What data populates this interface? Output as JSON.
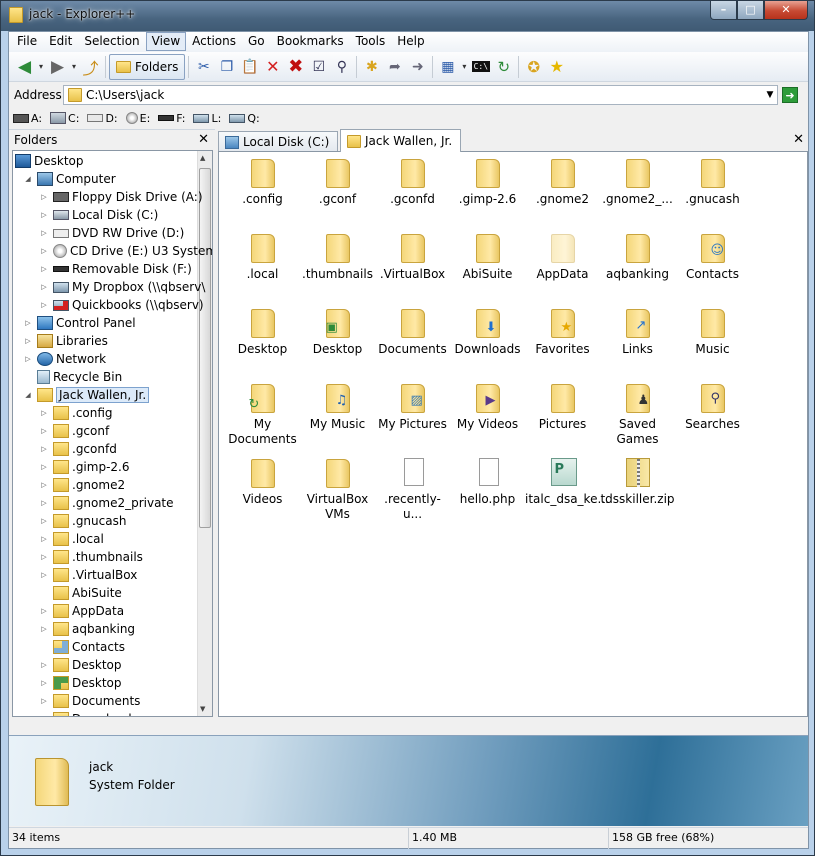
{
  "window": {
    "title": "jack - Explorer++",
    "min": "–",
    "max": "□",
    "close": "✕"
  },
  "menu": [
    "File",
    "Edit",
    "Selection",
    "View",
    "Actions",
    "Go",
    "Bookmarks",
    "Tools",
    "Help"
  ],
  "toolbar": {
    "folders_label": "Folders"
  },
  "address": {
    "label": "Address",
    "value": "C:\\Users\\jack"
  },
  "drives": [
    {
      "name": "floppy-drive",
      "label": "A:"
    },
    {
      "name": "local-drive",
      "label": "C:"
    },
    {
      "name": "dvd-drive",
      "label": "D:"
    },
    {
      "name": "cd-drive",
      "label": "E:"
    },
    {
      "name": "removable-drive",
      "label": "F:"
    },
    {
      "name": "network-drive-l",
      "label": "L:"
    },
    {
      "name": "network-drive-q",
      "label": "Q:"
    }
  ],
  "folders_pane": {
    "title": "Folders",
    "close": "✕"
  },
  "tree": [
    {
      "label": "Desktop",
      "icon": "desktop-icon",
      "level": 0,
      "exp": ""
    },
    {
      "label": "Computer",
      "icon": "computer-icon",
      "level": 1,
      "exp": "◢"
    },
    {
      "label": "Floppy Disk Drive (A:)",
      "icon": "floppy-icon",
      "level": 2,
      "exp": "▷"
    },
    {
      "label": "Local Disk (C:)",
      "icon": "hard-disk-icon",
      "level": 2,
      "exp": "▷"
    },
    {
      "label": "DVD RW Drive (D:)",
      "icon": "dvd-icon",
      "level": 2,
      "exp": "▷"
    },
    {
      "label": "CD Drive (E:) U3 System",
      "icon": "cd-icon",
      "level": 2,
      "exp": "▷"
    },
    {
      "label": "Removable Disk (F:)",
      "icon": "removable-disk-icon",
      "level": 2,
      "exp": "▷"
    },
    {
      "label": "My Dropbox (\\\\qbserv\\",
      "icon": "network-drive-icon",
      "level": 2,
      "exp": "▷"
    },
    {
      "label": "Quickbooks (\\\\qbserv)",
      "icon": "network-drive-disconnected-icon",
      "level": 2,
      "exp": "▷"
    },
    {
      "label": "Control Panel",
      "icon": "control-panel-icon",
      "level": 1,
      "exp": "▷"
    },
    {
      "label": "Libraries",
      "icon": "libraries-icon",
      "level": 1,
      "exp": "▷"
    },
    {
      "label": "Network",
      "icon": "network-icon",
      "level": 1,
      "exp": "▷"
    },
    {
      "label": "Recycle Bin",
      "icon": "recycle-bin-icon",
      "level": 1,
      "exp": ""
    },
    {
      "label": "Jack Wallen, Jr.",
      "icon": "user-folder-icon",
      "level": 1,
      "exp": "◢",
      "selected": true
    },
    {
      "label": ".config",
      "icon": "folder-icon",
      "level": 2,
      "exp": "▷"
    },
    {
      "label": ".gconf",
      "icon": "folder-icon",
      "level": 2,
      "exp": "▷"
    },
    {
      "label": ".gconfd",
      "icon": "folder-icon",
      "level": 2,
      "exp": "▷"
    },
    {
      "label": ".gimp-2.6",
      "icon": "folder-icon",
      "level": 2,
      "exp": "▷"
    },
    {
      "label": ".gnome2",
      "icon": "folder-icon",
      "level": 2,
      "exp": "▷"
    },
    {
      "label": ".gnome2_private",
      "icon": "folder-icon",
      "level": 2,
      "exp": "▷"
    },
    {
      "label": ".gnucash",
      "icon": "folder-icon",
      "level": 2,
      "exp": "▷"
    },
    {
      "label": ".local",
      "icon": "folder-icon",
      "level": 2,
      "exp": "▷"
    },
    {
      "label": ".thumbnails",
      "icon": "folder-icon",
      "level": 2,
      "exp": "▷"
    },
    {
      "label": ".VirtualBox",
      "icon": "folder-icon",
      "level": 2,
      "exp": "▷"
    },
    {
      "label": "AbiSuite",
      "icon": "folder-icon",
      "level": 2,
      "exp": ""
    },
    {
      "label": "AppData",
      "icon": "folder-icon",
      "level": 2,
      "exp": "▷"
    },
    {
      "label": "aqbanking",
      "icon": "folder-icon",
      "level": 2,
      "exp": "▷"
    },
    {
      "label": "Contacts",
      "icon": "contacts-folder-icon",
      "level": 2,
      "exp": ""
    },
    {
      "label": "Desktop",
      "icon": "folder-icon",
      "level": 2,
      "exp": "▷"
    },
    {
      "label": "Desktop",
      "icon": "desktop-shortcut-folder-icon",
      "level": 2,
      "exp": "▷"
    },
    {
      "label": "Documents",
      "icon": "folder-icon",
      "level": 2,
      "exp": "▷"
    },
    {
      "label": "Downloads",
      "icon": "folder-icon",
      "level": 2,
      "exp": ""
    }
  ],
  "tabs": [
    {
      "label": "Local Disk (C:)",
      "icon": "drive-tab-icon"
    },
    {
      "label": "Jack Wallen, Jr.",
      "icon": "user-folder-tab-icon"
    }
  ],
  "tab_close": "✕",
  "files": [
    {
      "label": ".config",
      "kind": "folder"
    },
    {
      "label": ".gconf",
      "kind": "folder"
    },
    {
      "label": ".gconfd",
      "kind": "folder"
    },
    {
      "label": ".gimp-2.6",
      "kind": "folder"
    },
    {
      "label": ".gnome2",
      "kind": "folder"
    },
    {
      "label": ".gnome2_...",
      "kind": "folder"
    },
    {
      "label": ".gnucash",
      "kind": "folder"
    },
    {
      "label": ".local",
      "kind": "folder"
    },
    {
      "label": ".thumbnails",
      "kind": "folder"
    },
    {
      "label": ".VirtualBox",
      "kind": "folder"
    },
    {
      "label": "AbiSuite",
      "kind": "folder"
    },
    {
      "label": "AppData",
      "kind": "folder-hidden"
    },
    {
      "label": "aqbanking",
      "kind": "folder"
    },
    {
      "label": "Contacts",
      "kind": "folder-contacts"
    },
    {
      "label": "Desktop",
      "kind": "folder"
    },
    {
      "label": "Desktop",
      "kind": "folder-desktop"
    },
    {
      "label": "Documents",
      "kind": "folder"
    },
    {
      "label": "Downloads",
      "kind": "folder-downloads"
    },
    {
      "label": "Favorites",
      "kind": "folder-favorites"
    },
    {
      "label": "Links",
      "kind": "folder-links"
    },
    {
      "label": "Music",
      "kind": "folder"
    },
    {
      "label": "My Documents",
      "kind": "folder-shortcut"
    },
    {
      "label": "My Music",
      "kind": "folder-music"
    },
    {
      "label": "My Pictures",
      "kind": "folder-pictures"
    },
    {
      "label": "My Videos",
      "kind": "folder-videos"
    },
    {
      "label": "Pictures",
      "kind": "folder"
    },
    {
      "label": "Saved Games",
      "kind": "folder-games"
    },
    {
      "label": "Searches",
      "kind": "folder-searches"
    },
    {
      "label": "Videos",
      "kind": "folder"
    },
    {
      "label": "VirtualBox VMs",
      "kind": "folder"
    },
    {
      "label": ".recently-u...",
      "kind": "file"
    },
    {
      "label": "hello.php",
      "kind": "file"
    },
    {
      "label": "italc_dsa_ke...",
      "kind": "file-pub"
    },
    {
      "label": "tdsskiller.zip",
      "kind": "file-zip"
    }
  ],
  "info": {
    "name": "jack",
    "type": "System Folder"
  },
  "status": {
    "items": "34 items",
    "size": "1.40 MB",
    "free": "158 GB free (68%)"
  },
  "colors": {
    "selection": "#dceaf9",
    "accent": "#3f5a74"
  }
}
